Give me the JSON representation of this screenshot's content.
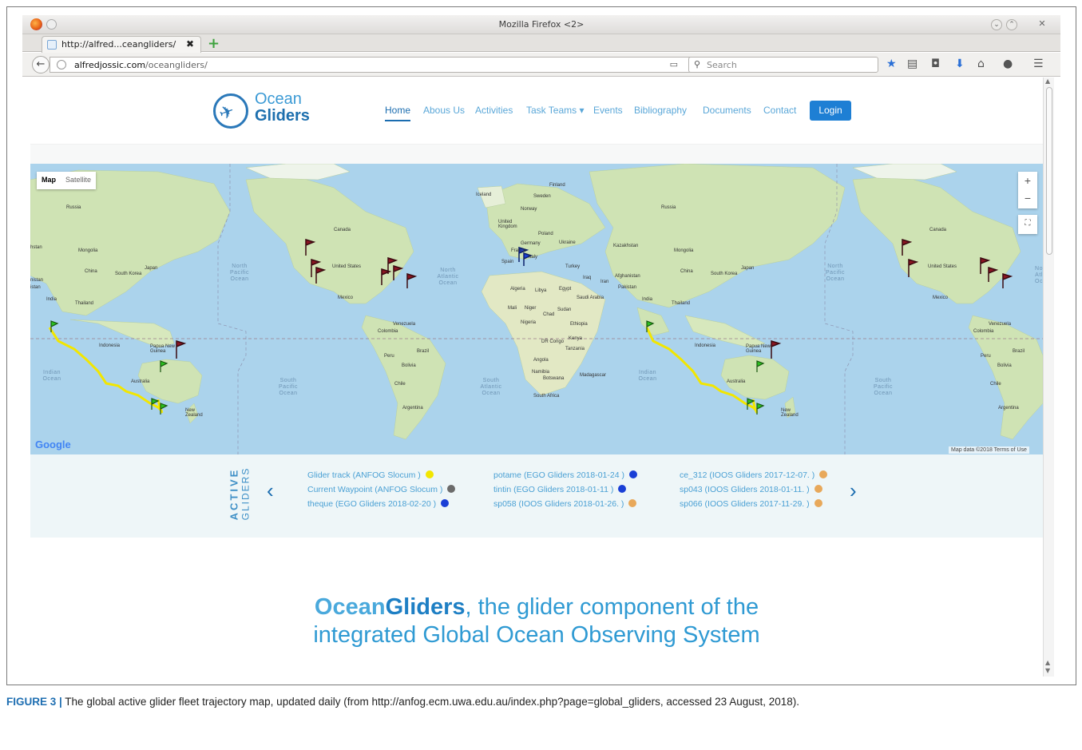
{
  "window": {
    "title": "Mozilla Firefox <2>"
  },
  "tab": {
    "label": "http://alfred...ceangliders/",
    "close": "✖",
    "new_tab": "+"
  },
  "nav": {
    "url_host": "alfredjossic.com",
    "url_path": "/oceangliders/",
    "search_placeholder": "Search"
  },
  "site": {
    "logo_line1": "Ocean",
    "logo_line2": "Gliders",
    "menu": [
      "Home",
      "Abous Us",
      "Activities",
      "Task Teams ▾",
      "Events",
      "Bibliography",
      "Documents",
      "Contact"
    ],
    "login": "Login"
  },
  "map": {
    "type_map": "Map",
    "type_satellite": "Satellite",
    "zoom_in": "+",
    "zoom_out": "−",
    "google": "Google",
    "credit": "Map data ©2018   Terms of Use",
    "labels": {
      "russia1": "Russia",
      "russia2": "Russia",
      "mongolia1": "Mongolia",
      "mongolia2": "Mongolia",
      "china1": "China",
      "china2": "China",
      "south_korea1": "South Korea",
      "south_korea2": "South Korea",
      "japan1": "Japan",
      "japan2": "Japan",
      "thailand1": "Thailand",
      "thailand2": "Thailand",
      "india1": "India",
      "india2": "India",
      "indonesia1": "Indonesia",
      "indonesia2": "Indonesia",
      "png1": "Papua New Guinea",
      "png2": "Papua New Guinea",
      "australia1": "Australia",
      "australia2": "Australia",
      "nz1": "New Zealand",
      "nz2": "New Zealand",
      "canada1": "Canada",
      "canada2": "Canada",
      "us1": "United States",
      "us2": "United States",
      "mexico1": "Mexico",
      "mexico2": "Mexico",
      "venezuela1": "Venezuela",
      "venezuela2": "Venezuela",
      "colombia1": "Colombia",
      "colombia2": "Colombia",
      "peru1": "Peru",
      "peru2": "Peru",
      "brazil1": "Brazil",
      "brazil2": "Brazil",
      "bolivia1": "Bolivia",
      "bolivia2": "Bolivia",
      "chile1": "Chile",
      "chile2": "Chile",
      "argentina1": "Argentina",
      "argentina2": "Argentina",
      "iceland": "Iceland",
      "finland": "Finland",
      "sweden": "Sweden",
      "norway": "Norway",
      "uk": "United Kingdom",
      "poland": "Poland",
      "germany": "Germany",
      "ukraine": "Ukraine",
      "france": "France",
      "italy": "Italy",
      "spain": "Spain",
      "turkey": "Turkey",
      "kazakhstan": "Kazakhstan",
      "iraq": "Iraq",
      "iran": "Iran",
      "afghanistan": "Afghanistan",
      "pakistan": "Pakistan",
      "algeria": "Algeria",
      "libya": "Libya",
      "egypt": "Egypt",
      "saudi": "Saudi Arabia",
      "mali": "Mali",
      "niger": "Niger",
      "chad": "Chad",
      "sudan": "Sudan",
      "nigeria": "Nigeria",
      "ethiopia": "Ethiopia",
      "drc": "DR Congo",
      "kenya": "Kenya",
      "tanzania": "Tanzania",
      "angola": "Angola",
      "namibia": "Namibia",
      "botswana": "Botswana",
      "madagascar": "Madagascar",
      "south_africa": "South Africa",
      "hstan": "hstan",
      "nistan": "nistan",
      "istan": "istan",
      "no_atl": "No Atl Oc"
    },
    "oceans": {
      "npo1": "North Pacific Ocean",
      "npo2": "North Pacific Ocean",
      "nao": "North Atlantic Ocean",
      "io1": "Indian Ocean",
      "io2": "Indian Ocean",
      "spo1": "South Pacific Ocean",
      "spo2": "South Pacific Ocean",
      "sao": "South Atlantic Ocean"
    }
  },
  "gliders": {
    "label_word1": "ACTIVE",
    "label_word2": "GLIDERS",
    "prev": "‹",
    "next": "›",
    "items": [
      {
        "label": "Glider track (ANFOG Slocum )",
        "color": "#f2e600"
      },
      {
        "label": "Current Waypoint (ANFOG Slocum )",
        "color": "#6b6b6b"
      },
      {
        "label": "theque (EGO Gliders 2018-02-20 )",
        "color": "#1a3fd6"
      },
      {
        "label": "potame (EGO Gliders 2018-01-24 )",
        "color": "#1a3fd6"
      },
      {
        "label": "tintin (EGO Gliders 2018-01-11 )",
        "color": "#1a3fd6"
      },
      {
        "label": "sp058 (IOOS Gliders 2018-01-26. )",
        "color": "#e8a85a"
      },
      {
        "label": "ce_312 (IOOS Gliders 2017-12-07. )",
        "color": "#e8a85a"
      },
      {
        "label": "sp043 (IOOS Gliders 2018-01-11. )",
        "color": "#e8a85a"
      },
      {
        "label": "sp066 (IOOS Gliders 2017-11-29. )",
        "color": "#e8a85a"
      }
    ]
  },
  "tagline": {
    "part1": "Ocean",
    "part2": "Gliders",
    "part3": ", the glider component of the",
    "line2": "integrated Global Ocean Observing System"
  },
  "caption": {
    "fig": "FIGURE 3 |",
    "text": " The global active glider fleet trajectory map, updated daily (from http://anfog.ecm.uwa.edu.au/index.php?page=global_gliders, accessed 23 August, 2018)."
  },
  "colors": {
    "ocean": "#abd3ec",
    "land": "#cfe3b4",
    "brand": "#1b6db0",
    "login": "#1e7fd4"
  }
}
